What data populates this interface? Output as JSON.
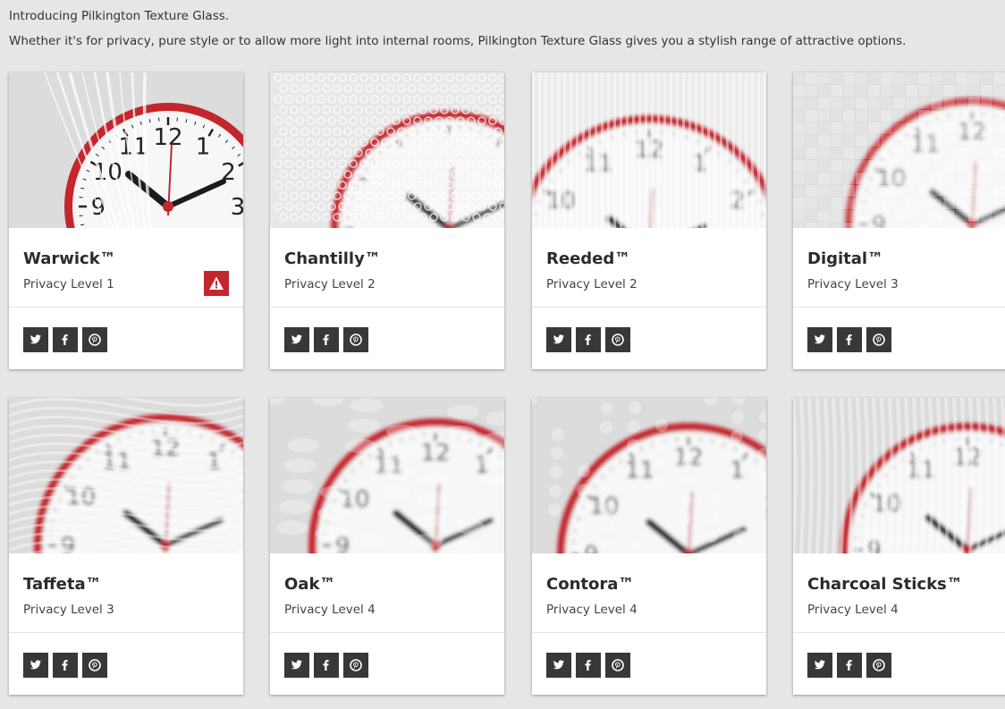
{
  "intro": {
    "headline": "Introducing Pilkington Texture Glass.",
    "description": "Whether it's for privacy, pure style or to allow more light into internal rooms, Pilkington Texture Glass gives you a stylish range of attractive options."
  },
  "colors": {
    "accent_red": "#c4262e",
    "social_button": "#383838",
    "background": "#e6e6e6"
  },
  "products": [
    {
      "name": "Warwick™",
      "privacy": "Privacy Level 1",
      "texture": "cracked",
      "has_warning": true
    },
    {
      "name": "Chantilly™",
      "privacy": "Privacy Level 2",
      "texture": "lace",
      "has_warning": false
    },
    {
      "name": "Reeded™",
      "privacy": "Privacy Level 2",
      "texture": "reeded",
      "has_warning": false
    },
    {
      "name": "Digital™",
      "privacy": "Privacy Level 3",
      "texture": "digital",
      "has_warning": false
    },
    {
      "name": "Taffeta™",
      "privacy": "Privacy Level 3",
      "texture": "swirl",
      "has_warning": false
    },
    {
      "name": "Oak™",
      "privacy": "Privacy Level 4",
      "texture": "oak",
      "has_warning": false
    },
    {
      "name": "Contora™",
      "privacy": "Privacy Level 4",
      "texture": "contora",
      "has_warning": false
    },
    {
      "name": "Charcoal Sticks™",
      "privacy": "Privacy Level 4",
      "texture": "sticks",
      "has_warning": false
    }
  ],
  "social_icons": [
    "twitter-icon",
    "facebook-icon",
    "pinterest-icon"
  ],
  "warning_icon": "warning-triangle-icon"
}
